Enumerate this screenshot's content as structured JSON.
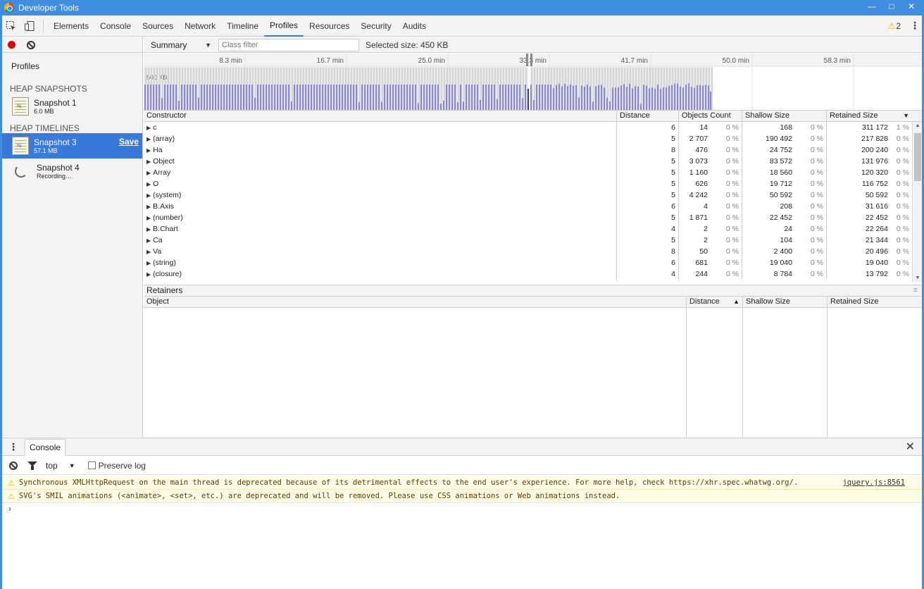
{
  "window": {
    "title": "Developer Tools"
  },
  "toolbar": {
    "tabs": [
      "Elements",
      "Console",
      "Sources",
      "Network",
      "Timeline",
      "Profiles",
      "Resources",
      "Security",
      "Audits"
    ],
    "active_tab": "Profiles",
    "warning_count": "2"
  },
  "sidebar": {
    "title": "Profiles",
    "heap_snapshots_title": "HEAP SNAPSHOTS",
    "heap_timelines_title": "HEAP TIMELINES",
    "snapshot1": {
      "name": "Snapshot 1",
      "size": "6.0 MB"
    },
    "snapshot3": {
      "name": "Snapshot 3",
      "size": "57.1 MB",
      "save": "Save"
    },
    "snapshot4": {
      "name": "Snapshot 4",
      "status": "Recording…"
    }
  },
  "summary": {
    "view": "Summary",
    "filter_placeholder": "Class filter",
    "selected_size": "Selected size: 450 KB"
  },
  "timeline": {
    "ticks": [
      "8.3 min",
      "16.7 min",
      "25.0 min",
      "33.3 min",
      "41.7 min",
      "50.0 min",
      "58.3 min"
    ],
    "y_label": "500 KB"
  },
  "constructors": {
    "headers": {
      "constructor": "Constructor",
      "distance": "Distance",
      "objects_count": "Objects Count",
      "shallow_size": "Shallow Size",
      "retained_size": "Retained Size"
    },
    "rows": [
      {
        "name": "c",
        "distance": "6",
        "count": "14",
        "count_pct": "0 %",
        "shallow": "168",
        "shallow_pct": "0 %",
        "retained": "311 172",
        "retained_pct": "1 %"
      },
      {
        "name": "(array)",
        "distance": "5",
        "count": "2 707",
        "count_pct": "0 %",
        "shallow": "190 492",
        "shallow_pct": "0 %",
        "retained": "217 828",
        "retained_pct": "0 %"
      },
      {
        "name": "Ha",
        "distance": "8",
        "count": "476",
        "count_pct": "0 %",
        "shallow": "24 752",
        "shallow_pct": "0 %",
        "retained": "200 240",
        "retained_pct": "0 %"
      },
      {
        "name": "Object",
        "distance": "5",
        "count": "3 073",
        "count_pct": "0 %",
        "shallow": "83 572",
        "shallow_pct": "0 %",
        "retained": "131 976",
        "retained_pct": "0 %"
      },
      {
        "name": "Array",
        "distance": "5",
        "count": "1 160",
        "count_pct": "0 %",
        "shallow": "18 560",
        "shallow_pct": "0 %",
        "retained": "120 320",
        "retained_pct": "0 %"
      },
      {
        "name": "O",
        "distance": "5",
        "count": "626",
        "count_pct": "0 %",
        "shallow": "19 712",
        "shallow_pct": "0 %",
        "retained": "116 752",
        "retained_pct": "0 %"
      },
      {
        "name": "(system)",
        "distance": "5",
        "count": "4 242",
        "count_pct": "0 %",
        "shallow": "50 592",
        "shallow_pct": "0 %",
        "retained": "50 592",
        "retained_pct": "0 %"
      },
      {
        "name": "B.Axis",
        "distance": "6",
        "count": "4",
        "count_pct": "0 %",
        "shallow": "208",
        "shallow_pct": "0 %",
        "retained": "31 616",
        "retained_pct": "0 %"
      },
      {
        "name": "(number)",
        "distance": "5",
        "count": "1 871",
        "count_pct": "0 %",
        "shallow": "22 452",
        "shallow_pct": "0 %",
        "retained": "22 452",
        "retained_pct": "0 %"
      },
      {
        "name": "B.Chart",
        "distance": "4",
        "count": "2",
        "count_pct": "0 %",
        "shallow": "24",
        "shallow_pct": "0 %",
        "retained": "22 264",
        "retained_pct": "0 %"
      },
      {
        "name": "Ca",
        "distance": "5",
        "count": "2",
        "count_pct": "0 %",
        "shallow": "104",
        "shallow_pct": "0 %",
        "retained": "21 344",
        "retained_pct": "0 %"
      },
      {
        "name": "Va",
        "distance": "8",
        "count": "50",
        "count_pct": "0 %",
        "shallow": "2 400",
        "shallow_pct": "0 %",
        "retained": "20 496",
        "retained_pct": "0 %"
      },
      {
        "name": "(string)",
        "distance": "6",
        "count": "681",
        "count_pct": "0 %",
        "shallow": "19 040",
        "shallow_pct": "0 %",
        "retained": "19 040",
        "retained_pct": "0 %"
      },
      {
        "name": "(closure)",
        "distance": "4",
        "count": "244",
        "count_pct": "0 %",
        "shallow": "8 784",
        "shallow_pct": "0 %",
        "retained": "13 792",
        "retained_pct": "0 %"
      }
    ]
  },
  "retainers": {
    "title": "Retainers",
    "headers": {
      "object": "Object",
      "distance": "Distance",
      "shallow_size": "Shallow Size",
      "retained_size": "Retained Size"
    }
  },
  "console": {
    "tab": "Console",
    "context": "top",
    "preserve_log": "Preserve log",
    "messages": [
      {
        "text": "Synchronous XMLHttpRequest on the main thread is deprecated because of its detrimental effects to the end user's experience. For more help, check https://xhr.spec.whatwg.org/.",
        "source": "jquery.js:8561"
      },
      {
        "text": "SVG's SMIL animations (<animate>, <set>, etc.) are deprecated and will be removed. Please use CSS animations or Web animations instead.",
        "source": ""
      }
    ],
    "prompt": "›"
  },
  "colors": {
    "accent": "#3879d9",
    "titlebar": "#3f8ee0",
    "record": "#d80000",
    "warning_bg": "#fffbe5",
    "bars": "#8b85d6"
  }
}
